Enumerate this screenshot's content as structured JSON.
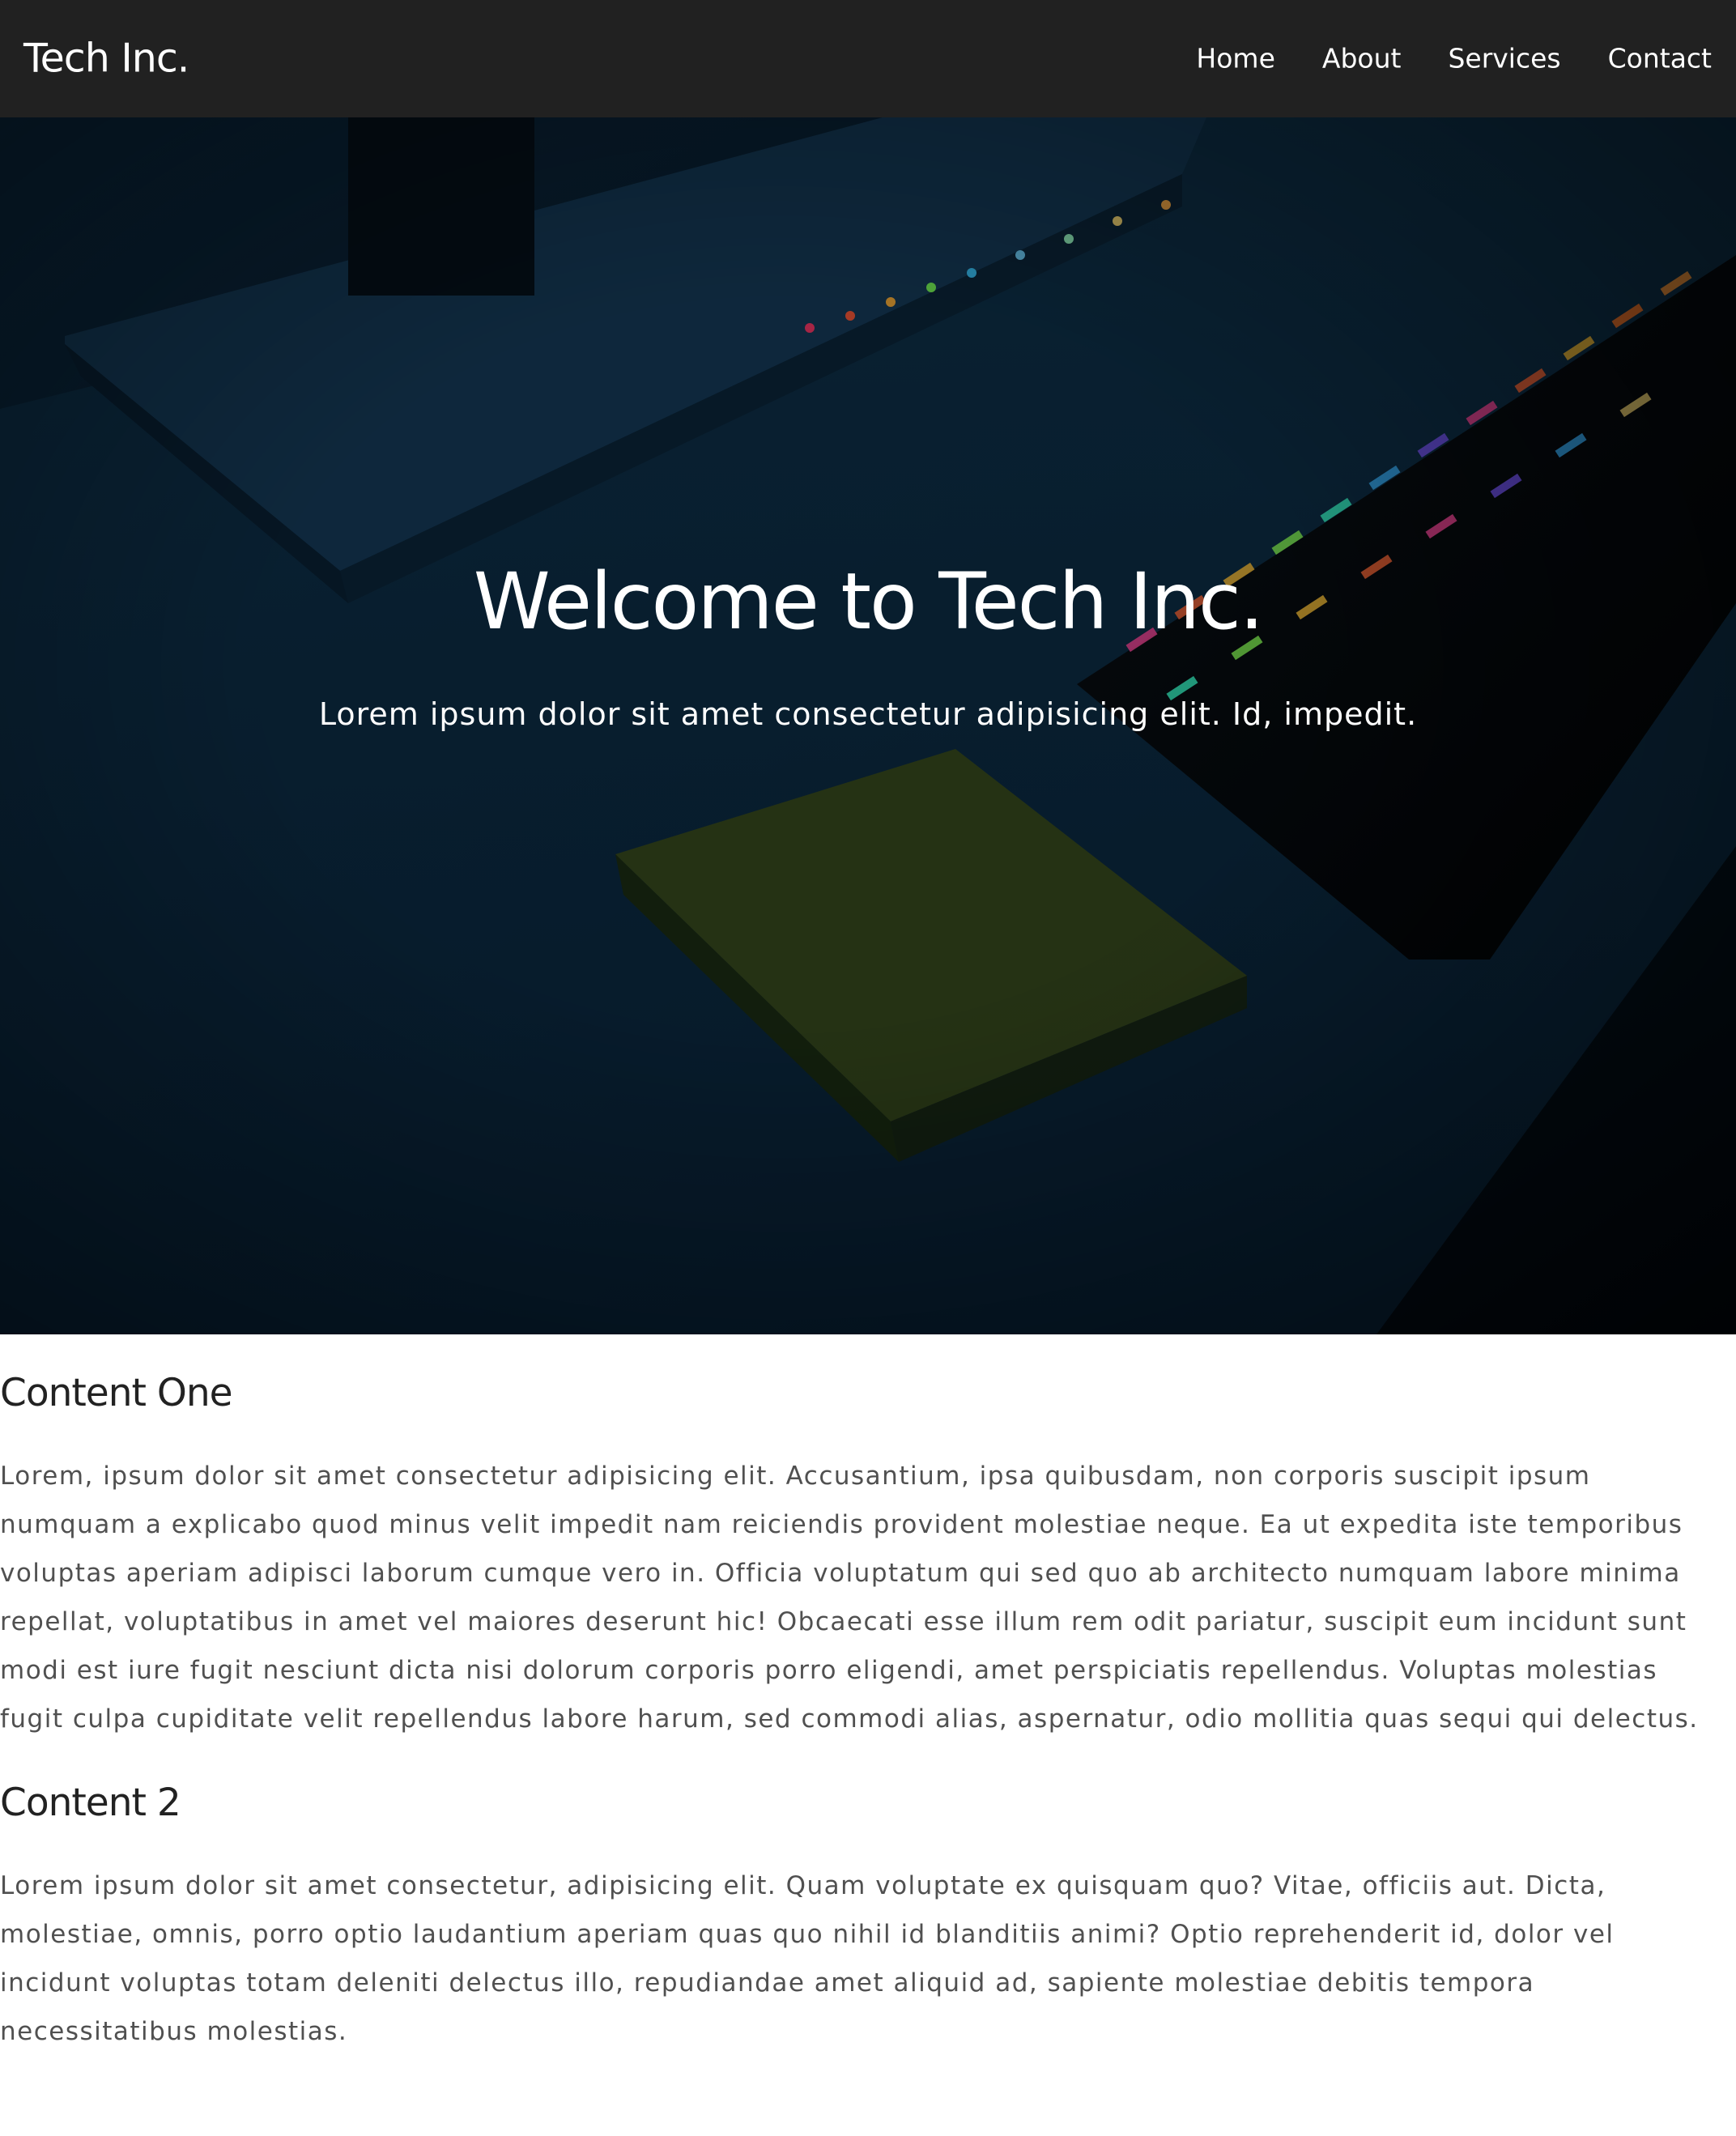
{
  "header": {
    "brand": "Tech Inc.",
    "nav": [
      "Home",
      "About",
      "Services",
      "Contact"
    ]
  },
  "hero": {
    "title": "Welcome to Tech Inc.",
    "subtitle": "Lorem ipsum dolor sit amet consectetur adipisicing elit. Id, impedit.",
    "image_description_color": "#061521"
  },
  "sections": [
    {
      "heading": "Content One",
      "body": "Lorem, ipsum dolor sit amet consectetur adipisicing elit. Accusantium, ipsa quibusdam, non corporis suscipit ipsum numquam a explicabo quod minus velit impedit nam reiciendis provident molestiae neque. Ea ut expedita iste temporibus voluptas aperiam adipisci laborum cumque vero in. Officia voluptatum qui sed quo ab architecto numquam labore minima repellat, voluptatibus in amet vel maiores deserunt hic! Obcaecati esse illum rem odit pariatur, suscipit eum incidunt sunt modi est iure fugit nesciunt dicta nisi dolorum corporis porro eligendi, amet perspiciatis repellendus. Voluptas molestias fugit culpa cupiditate velit repellendus labore harum, sed commodi alias, aspernatur, odio mollitia quas sequi qui delectus."
    },
    {
      "heading": "Content 2",
      "body": "Lorem ipsum dolor sit amet consectetur, adipisicing elit. Quam voluptate ex quisquam quo? Vitae, officiis aut. Dicta, molestiae, omnis, porro optio laudantium aperiam quas quo nihil id blanditiis animi? Optio reprehenderit id, dolor vel incidunt voluptas totam deleniti delectus illo, repudiandae amet aliquid ad, sapiente molestiae debitis tempora necessitatibus molestias."
    }
  ],
  "colors": {
    "navbar_bg": "#212121",
    "heading": "#222222",
    "body_text": "#505050"
  }
}
